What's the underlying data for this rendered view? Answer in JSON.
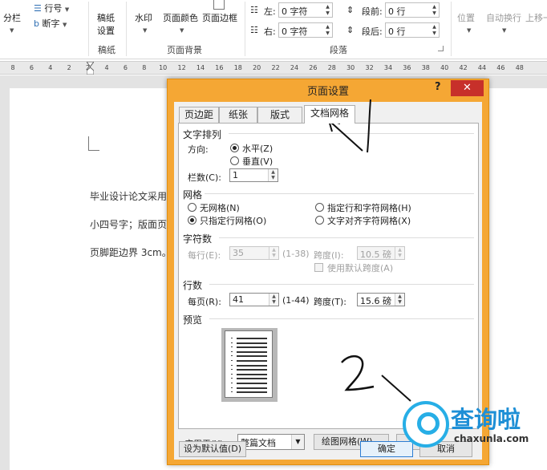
{
  "ribbon": {
    "columns_btn": "分栏",
    "line_numbers": "行号",
    "hyphenation": "断字",
    "paper_settings_1": "稿纸",
    "paper_settings_2": "设置",
    "paper_group": "稿纸",
    "watermark": "水印",
    "page_color": "页面颜色",
    "page_borders": "页面边框",
    "page_bg_group": "页面背景",
    "indent_left_label": "左:",
    "indent_left_value": "0 字符",
    "indent_right_label": "右:",
    "indent_right_value": "0 字符",
    "space_before_label": "段前:",
    "space_before_value": "0 行",
    "space_after_label": "段后:",
    "space_after_value": "0 行",
    "paragraph_group": "段落",
    "position": "位置",
    "wrap_text": "自动换行",
    "bring_forward": "上移一"
  },
  "ruler": {
    "ticks": [
      "8",
      "6",
      "4",
      "2",
      "2",
      "4",
      "6",
      "8",
      "10",
      "12",
      "14",
      "16",
      "18",
      "20",
      "22",
      "24",
      "26",
      "28",
      "30",
      "32",
      "34",
      "36",
      "38",
      "40",
      "42",
      "44",
      "46",
      "48"
    ]
  },
  "document": {
    "line1": "毕业设计论文采用",
    "line2": "小四号字；版面页",
    "line3": "页脚距边界 3cm。"
  },
  "dialog": {
    "title": "页面设置",
    "help": "?",
    "close": "✕",
    "tabs": [
      "页边距",
      "纸张",
      "版式",
      "文档网格"
    ],
    "text_direction": {
      "title": "文字排列",
      "direction_label": "方向:",
      "horizontal": "水平(Z)",
      "vertical": "垂直(V)",
      "columns_label": "栏数(C):",
      "columns_value": "1"
    },
    "grid": {
      "title": "网格",
      "no_grid": "无网格(N)",
      "char_line_grid": "指定行和字符网格(H)",
      "line_grid_only": "只指定行网格(O)",
      "snap_to_char": "文字对齐字符网格(X)"
    },
    "characters": {
      "title": "字符数",
      "per_line_label": "每行(E):",
      "per_line_value": "35",
      "per_line_range": "(1-38)",
      "pitch_label": "跨度(I):",
      "pitch_value": "10.5 磅",
      "use_default": "使用默认跨度(A)"
    },
    "lines": {
      "title": "行数",
      "per_page_label": "每页(R):",
      "per_page_value": "41",
      "per_page_range": "(1-44)",
      "pitch_label": "跨度(T):",
      "pitch_value": "15.6 磅"
    },
    "preview": {
      "title": "预览"
    },
    "apply_to_label": "应用于(Y):",
    "apply_to_value": "整篇文档",
    "drawing_grid_btn": "绘图网格(W)...",
    "font_settings_btn": "字",
    "set_default_btn": "设为默认值(D)",
    "ok_btn": "确定",
    "cancel_btn": "取消"
  },
  "annotation": {
    "step_number": "2"
  },
  "watermark": {
    "brand": "查询啦",
    "url": "chaxunla.com"
  },
  "colors": {
    "dialog_frame": "#f5a734",
    "close_button": "#c7302a",
    "watermark_blue": "#27aee6"
  }
}
